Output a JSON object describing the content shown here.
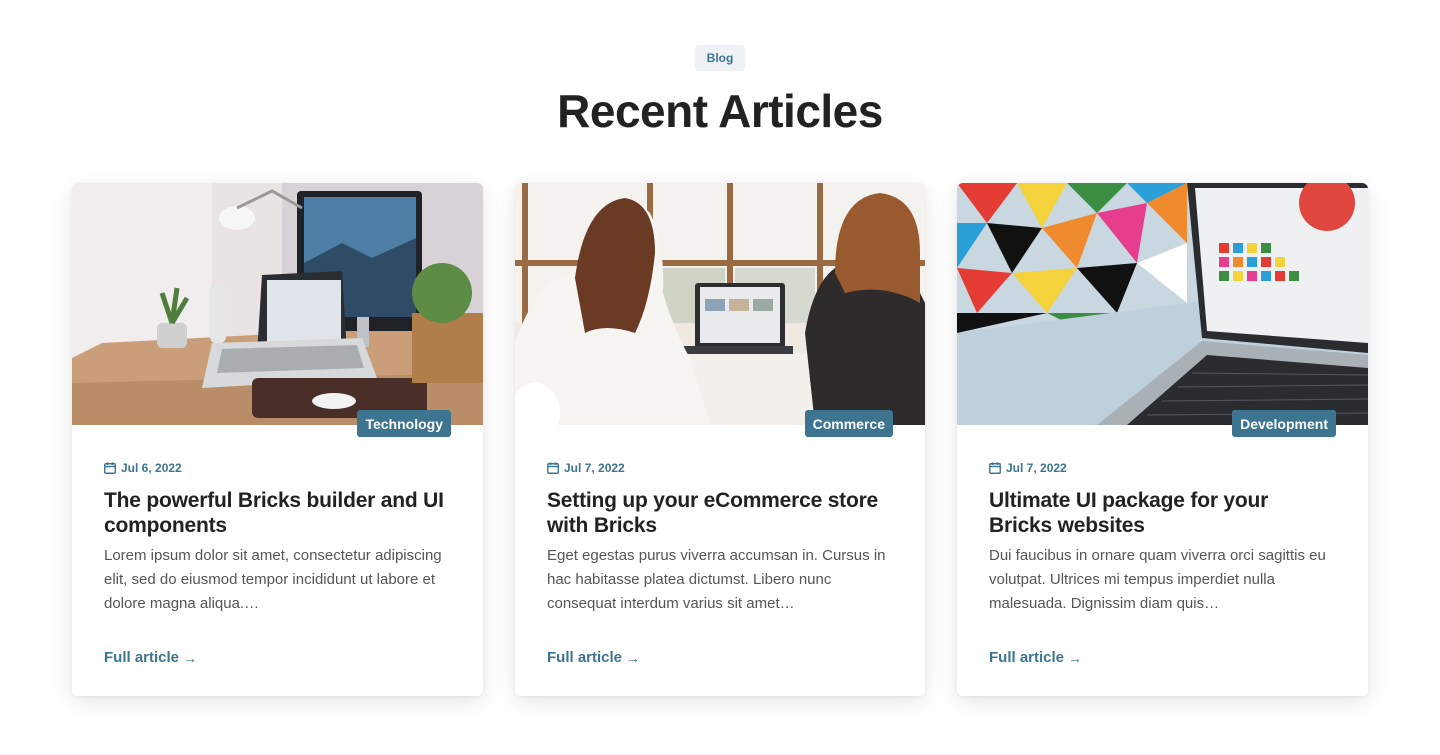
{
  "header": {
    "badge": "Blog",
    "title": "Recent Articles"
  },
  "colors": {
    "accent": "#3d7590",
    "badge_bg": "#eef2f5",
    "heading": "#222222"
  },
  "cards": [
    {
      "category": "Technology",
      "date": "Jul 6, 2022",
      "title": "The powerful Bricks builder and UI components",
      "excerpt": "Lorem ipsum dolor sit amet, consectetur adipiscing elit, sed do eiusmod tempor incididunt ut labore et dolore magna aliqua.…",
      "link": "Full article",
      "image_alt": "desk with laptop, monitor and lamp"
    },
    {
      "category": "Commerce",
      "date": "Jul 7, 2022",
      "title": "Setting up your eCommerce store with Bricks",
      "excerpt": "Eget egestas purus viverra accumsan in. Cursus in hac habitasse platea dictumst. Libero nunc consequat interdum varius sit amet…",
      "link": "Full article",
      "image_alt": "two women working at a laptop"
    },
    {
      "category": "Development",
      "date": "Jul 7, 2022",
      "title": "Ultimate UI package for your Bricks websites",
      "excerpt": "Dui faucibus in ornare quam viverra orci sagittis eu volutpat. Ultrices mi tempus imperdiet nulla malesuada. Dignissim diam quis…",
      "link": "Full article",
      "image_alt": "laptop in front of colorful geometric wall"
    }
  ]
}
